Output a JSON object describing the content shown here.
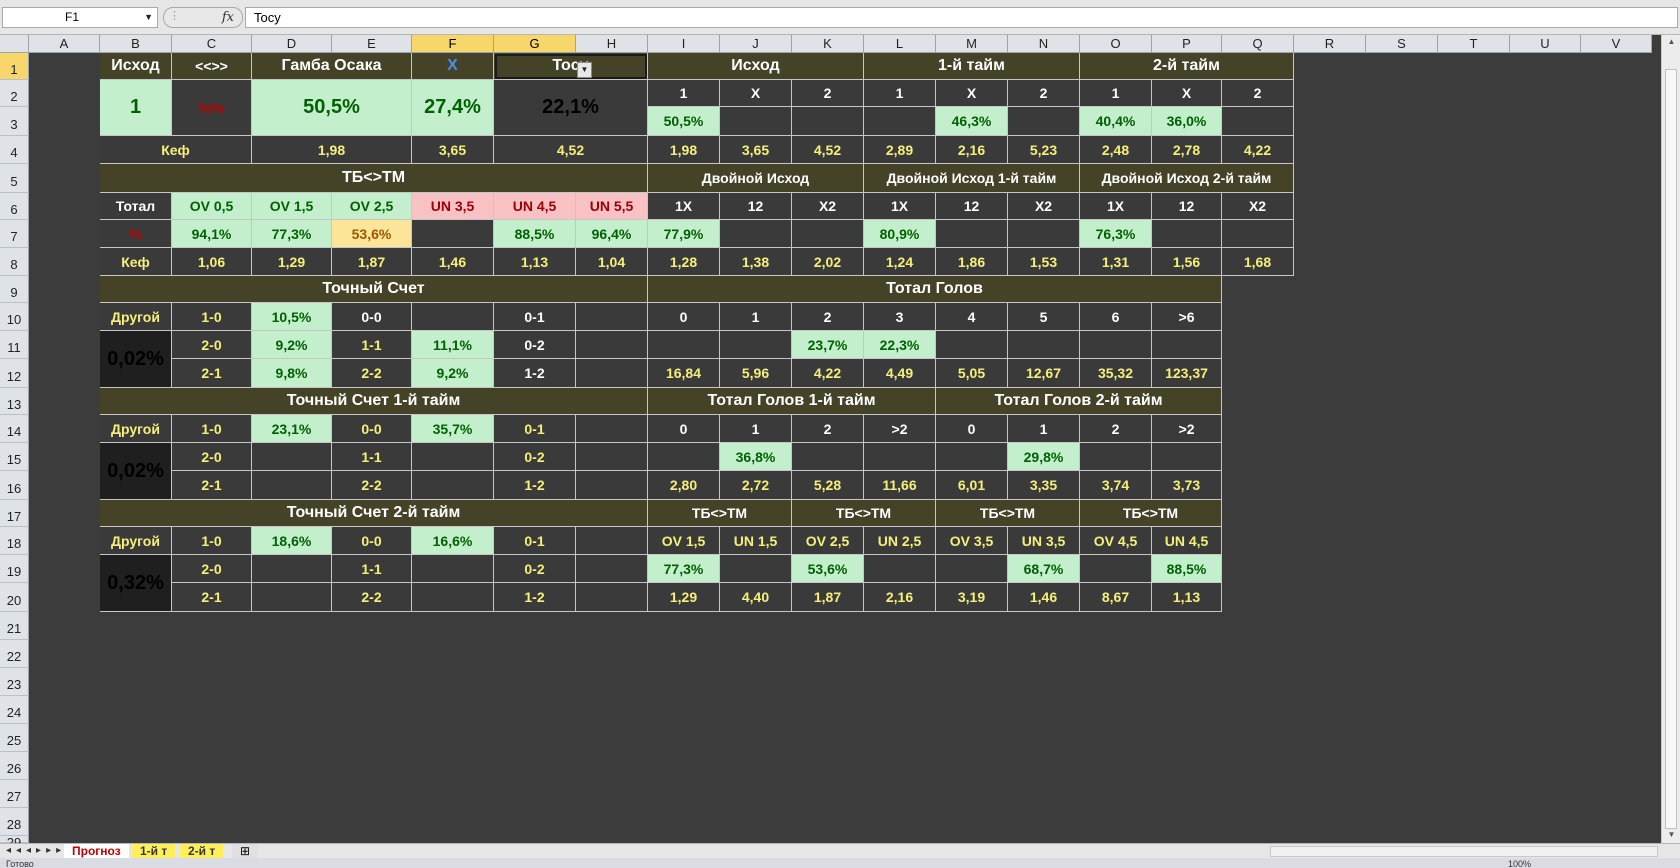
{
  "namebox": "F1",
  "formula_value": "Tocy",
  "columns": [
    "A",
    "B",
    "C",
    "D",
    "E",
    "F",
    "G",
    "H",
    "I",
    "J",
    "K",
    "L",
    "M",
    "N",
    "O",
    "P",
    "Q",
    "R",
    "S",
    "T",
    "U",
    "V"
  ],
  "rows": [
    "1",
    "2",
    "3",
    "4",
    "5",
    "6",
    "7",
    "8",
    "9",
    "10",
    "11",
    "12",
    "13",
    "14",
    "15",
    "16",
    "17",
    "18",
    "19",
    "20",
    "21",
    "22",
    "23",
    "24",
    "25",
    "26",
    "27",
    "28",
    "29"
  ],
  "cells": {
    "r1": [
      "Исход",
      "<<>>",
      "Гамба Осака",
      "X",
      "Tocy",
      "Исход",
      "1-й тайм",
      "2-й тайм"
    ],
    "r2": [
      "1",
      "%%",
      "50,5%",
      "27,4%",
      "22,1%",
      "1",
      "X",
      "2",
      "1",
      "X",
      "2",
      "1",
      "X",
      "2"
    ],
    "r3": [
      "50,5%",
      "46,3%",
      "40,4%",
      "36,0%"
    ],
    "r4": [
      "Кеф",
      "1,98",
      "3,65",
      "4,52",
      "1,98",
      "3,65",
      "4,52",
      "2,89",
      "2,16",
      "5,23",
      "2,48",
      "2,78",
      "4,22"
    ],
    "r5": [
      "ТБ<>ТМ",
      "Двойной Исход",
      "Двойной Исход 1-й тайм",
      "Двойной Исход 2-й тайм"
    ],
    "r6": [
      "Тотал",
      "OV 0,5",
      "OV 1,5",
      "OV 2,5",
      "UN 3,5",
      "UN 4,5",
      "UN 5,5",
      "1X",
      "12",
      "X2",
      "1X",
      "12",
      "X2",
      "1X",
      "12",
      "X2"
    ],
    "r7": [
      "%",
      "94,1%",
      "77,3%",
      "53,6%",
      "88,5%",
      "96,4%",
      "77,9%",
      "80,9%",
      "76,3%"
    ],
    "r8": [
      "Кеф",
      "1,06",
      "1,29",
      "1,87",
      "1,46",
      "1,13",
      "1,04",
      "1,28",
      "1,38",
      "2,02",
      "1,24",
      "1,86",
      "1,53",
      "1,31",
      "1,56",
      "1,68"
    ],
    "r9": [
      "Точный Счет",
      "Тотал Голов"
    ],
    "r10": [
      "Другой",
      "1-0",
      "10,5%",
      "0-0",
      "0-1",
      "0",
      "1",
      "2",
      "3",
      "4",
      "5",
      "6",
      ">6"
    ],
    "r11": [
      "0,02%",
      "2-0",
      "9,2%",
      "1-1",
      "11,1%",
      "0-2",
      "23,7%",
      "22,3%"
    ],
    "r12": [
      "2-1",
      "9,8%",
      "2-2",
      "9,2%",
      "1-2",
      "16,84",
      "5,96",
      "4,22",
      "4,49",
      "5,05",
      "12,67",
      "35,32",
      "123,37"
    ],
    "r13": [
      "Точный Счет 1-й тайм",
      "Тотал Голов 1-й тайм",
      "Тотал Голов 2-й тайм"
    ],
    "r14": [
      "Другой",
      "1-0",
      "23,1%",
      "0-0",
      "35,7%",
      "0-1",
      "0",
      "1",
      "2",
      ">2",
      "0",
      "1",
      "2",
      ">2"
    ],
    "r15": [
      "0,02%",
      "2-0",
      "1-1",
      "0-2",
      "36,8%",
      "29,8%"
    ],
    "r16": [
      "2-1",
      "2-2",
      "1-2",
      "2,80",
      "2,72",
      "5,28",
      "11,66",
      "6,01",
      "3,35",
      "3,74",
      "3,73"
    ],
    "r17": [
      "Точный Счет 2-й тайм",
      "ТБ<>ТМ",
      "ТБ<>ТМ",
      "ТБ<>ТМ",
      "ТБ<>ТМ"
    ],
    "r18": [
      "Другой",
      "1-0",
      "18,6%",
      "0-0",
      "16,6%",
      "0-1",
      "OV 1,5",
      "UN 1,5",
      "OV 2,5",
      "UN 2,5",
      "OV 3,5",
      "UN 3,5",
      "OV 4,5",
      "UN 4,5"
    ],
    "r19": [
      "0,32%",
      "2-0",
      "1-1",
      "0-2",
      "77,3%",
      "53,6%",
      "68,7%",
      "88,5%"
    ],
    "r20": [
      "2-1",
      "2-2",
      "1-2",
      "1,29",
      "4,40",
      "1,87",
      "2,16",
      "3,19",
      "1,46",
      "8,67",
      "1,13"
    ]
  },
  "tabs": [
    "Прогноз",
    "1-й т",
    "2-й т"
  ],
  "status_text": "Готово",
  "zoom": "100%"
}
